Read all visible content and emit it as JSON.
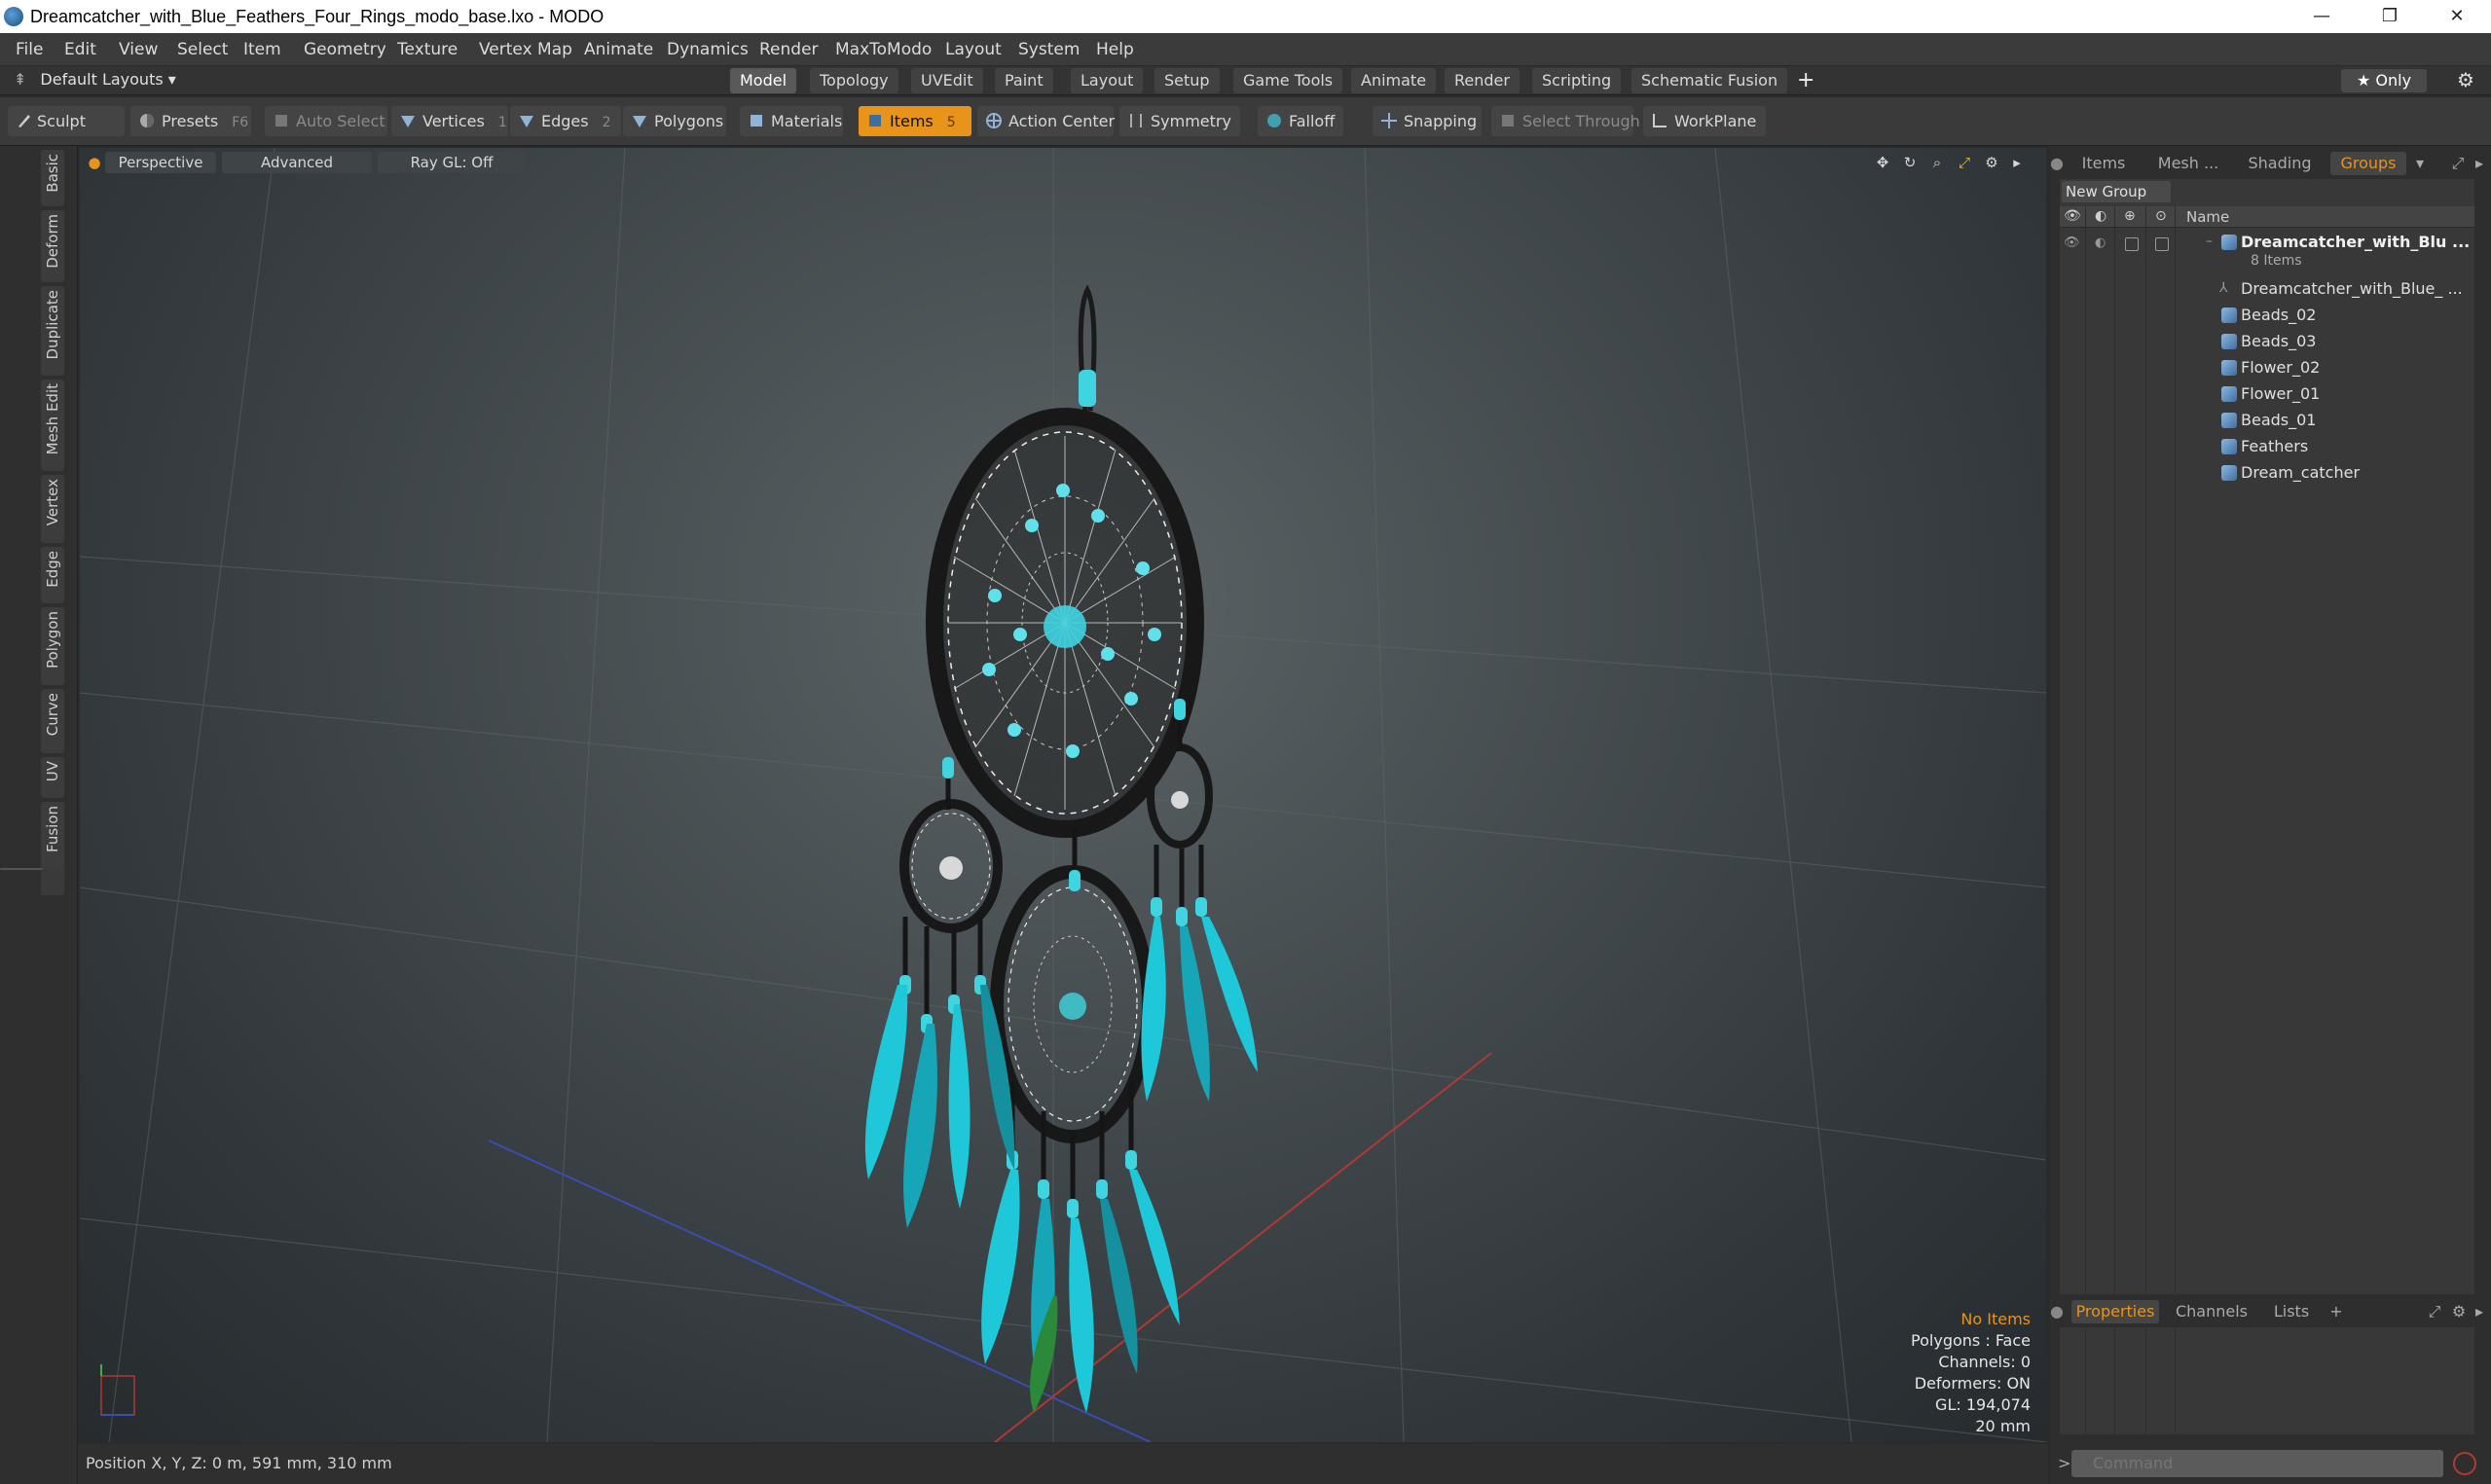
{
  "window": {
    "title": "Dreamcatcher_with_Blue_Feathers_Four_Rings_modo_base.lxo - MODO",
    "minimize": "—",
    "maximize": "❐",
    "close": "✕"
  },
  "menu": [
    "File",
    "Edit",
    "View",
    "Select",
    "Item",
    "Geometry",
    "Texture",
    "Vertex Map",
    "Animate",
    "Dynamics",
    "Render",
    "MaxToModo",
    "Layout",
    "System",
    "Help"
  ],
  "layoutbar": {
    "layouts_label": "Default Layouts ▾",
    "tabs": [
      "Model",
      "Topology",
      "UVEdit",
      "Paint",
      "Layout",
      "Setup",
      "Game Tools",
      "Animate",
      "Render",
      "Scripting",
      "Schematic Fusion"
    ],
    "active_tab": "Model",
    "add": "+",
    "only_label": "★  Only",
    "gear": "⚙"
  },
  "toolbar": {
    "sculpt": "Sculpt",
    "presets": "Presets",
    "presets_key": "F6",
    "auto_select": "Auto Select",
    "vertices": "Vertices",
    "vertices_count": "1",
    "edges": "Edges",
    "edges_count": "2",
    "polygons": "Polygons",
    "materials": "Materials",
    "items": "Items",
    "items_count": "5",
    "action_center": "Action Center",
    "symmetry": "Symmetry",
    "falloff": "Falloff",
    "snapping": "Snapping",
    "select_through": "Select Through",
    "workplane": "WorkPlane"
  },
  "left_tabs": [
    "Basic",
    "Deform",
    "Duplicate",
    "Mesh Edit",
    "Vertex",
    "Edge",
    "Polygon",
    "Curve",
    "UV",
    "Fusion"
  ],
  "viewport": {
    "perspective": "Perspective",
    "advanced": "Advanced",
    "raygl": "Ray GL: Off",
    "info": {
      "no_items": "No Items",
      "polygons": "Polygons : Face",
      "channels": "Channels: 0",
      "deformers": "Deformers: ON",
      "gl": "GL: 194,074",
      "scale": "20 mm"
    }
  },
  "status": {
    "position": "Position X, Y, Z:   0 m, 591 mm, 310 mm"
  },
  "right_panel": {
    "tabs": [
      "Items",
      "Mesh ...",
      "Shading",
      "Groups"
    ],
    "active_tab": "Groups",
    "new_group": "New Group",
    "name_header": "Name",
    "root": {
      "name": "Dreamcatcher_with_Blu ...",
      "count": "8 Items"
    },
    "children": [
      "Dreamcatcher_with_Blue_ ...",
      "Beads_02",
      "Beads_03",
      "Flower_02",
      "Flower_01",
      "Beads_01",
      "Feathers",
      "Dream_catcher"
    ],
    "bottom_tabs": [
      "Properties",
      "Channels",
      "Lists",
      "+"
    ],
    "command_placeholder": "Command"
  },
  "colors": {
    "accent": "#e8941a",
    "bead": "#3fd4e0",
    "feather": "#1fc8d8"
  }
}
